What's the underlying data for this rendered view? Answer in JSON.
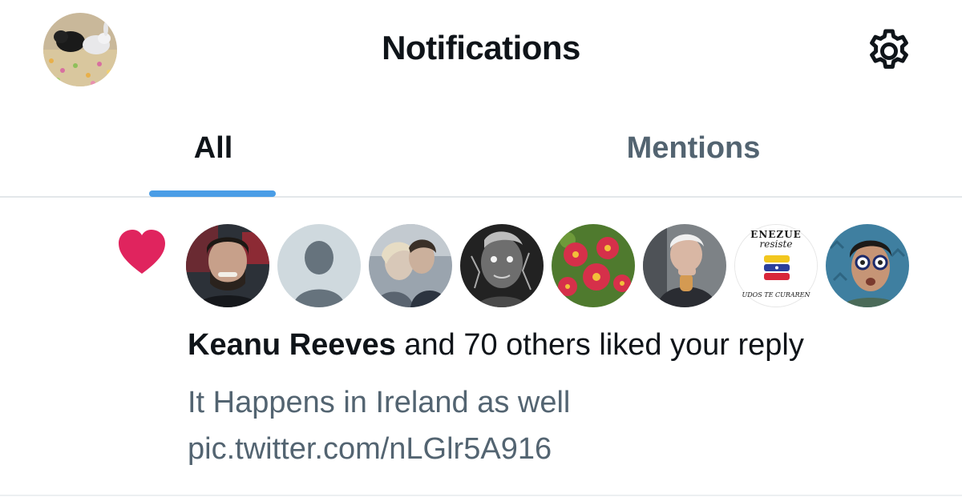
{
  "header": {
    "title": "Notifications",
    "account_avatar_icon": "rabbits-avatar",
    "settings_icon": "gear-icon"
  },
  "tabs": [
    {
      "label": "All",
      "selected": true
    },
    {
      "label": "Mentions",
      "selected": false
    }
  ],
  "notification": {
    "type_icon": "heart-icon",
    "type_color": "#e0245e",
    "actor_name": "Keanu Reeves",
    "summary_rest": " and 70 others liked your reply",
    "preview_text": "It Happens in Ireland as well pic.twitter.com/nLGlr5A916",
    "avatars": [
      {
        "name": "Keanu Reeves avatar"
      },
      {
        "name": "default-profile avatar"
      },
      {
        "name": "couple photo avatar"
      },
      {
        "name": "grayscale face avatar"
      },
      {
        "name": "flowers avatar"
      },
      {
        "name": "man eating avatar"
      },
      {
        "name": "Venezuela resiste avatar",
        "text_top": "ENEZUE",
        "text_mid": "resiste",
        "text_bottom": "UDOS TE CURAREN"
      },
      {
        "name": "man with glasses avatar"
      }
    ]
  },
  "colors": {
    "accent": "#4a9de6",
    "text_primary": "#0f1419",
    "text_secondary": "#536471",
    "like": "#e0245e"
  }
}
